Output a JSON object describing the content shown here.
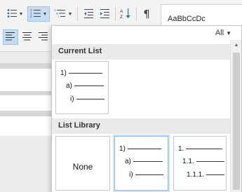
{
  "ribbon": {
    "styles_sample": "AaBbCcDc"
  },
  "dropdown": {
    "filter_label": "All",
    "current_list_header": "Current List",
    "list_library_header": "List Library",
    "current_list": {
      "levels": [
        "1)",
        "a)",
        "i)"
      ]
    },
    "library": [
      {
        "label": "None"
      },
      {
        "levels": [
          "1)",
          "a)",
          "i)"
        ]
      },
      {
        "levels": [
          "1.",
          "1.1.",
          "1.1.1."
        ]
      }
    ]
  },
  "icons": {
    "bullets": "bullets-icon",
    "numbering": "numbering-icon",
    "multilevel": "multilevel-list-icon",
    "decrease_indent": "decrease-indent-icon",
    "increase_indent": "increase-indent-icon",
    "sort": "sort-icon",
    "show_marks": "pilcrow-icon",
    "align_left": "align-left-icon",
    "align_center": "align-center-icon",
    "align_right": "align-right-icon"
  },
  "colors": {
    "accent_active": "#c5dcf2",
    "icon_blue": "#2b6cb0",
    "selected_border": "#8fbde8"
  }
}
